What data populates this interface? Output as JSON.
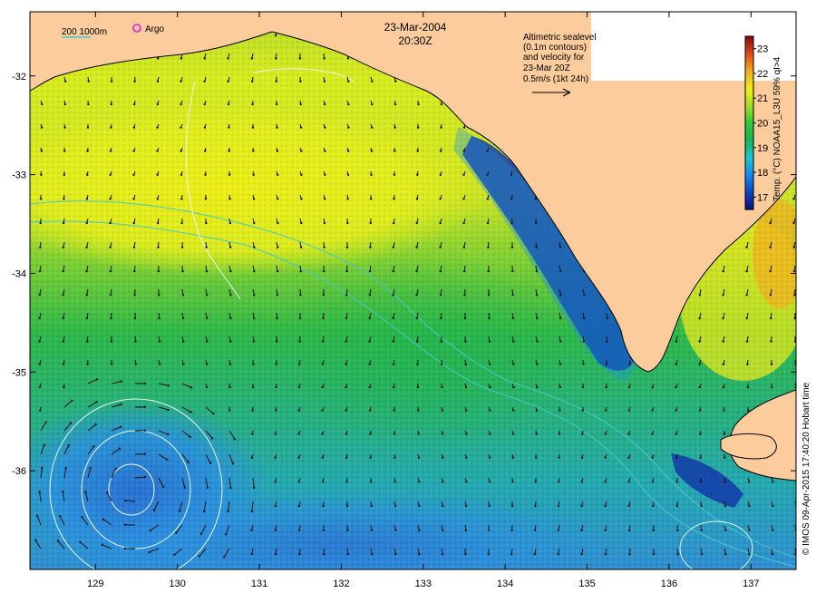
{
  "header": {
    "date": "23-Mar-2004",
    "time": "20:30Z"
  },
  "legend": {
    "isobath_label": "200  1000m",
    "argo_label": "Argo",
    "isobath_color": "#46c8c8",
    "argo_color": "#e020e0"
  },
  "annotation": {
    "lines": [
      "Altimetric sealevel",
      "(0.1m contours)",
      "and velocity for",
      "23-Mar 20Z",
      "0.5m/s (1kt 24h)"
    ]
  },
  "colorbar": {
    "label": "Temp. (°C) NOAA15_L3U 59% qI>4",
    "ticks": [
      "17",
      "18",
      "19",
      "20",
      "21",
      "22",
      "23"
    ],
    "range": [
      16.5,
      23.5
    ],
    "stops": [
      "#0a1478",
      "#0a46c8",
      "#148cf0",
      "#19c8d2",
      "#14b45a",
      "#2ec83c",
      "#a0dc28",
      "#f0f014",
      "#f0b41e",
      "#e6501e",
      "#8c0f0f"
    ]
  },
  "map": {
    "x_ticks": [
      "129",
      "130",
      "131",
      "132",
      "133",
      "134",
      "135",
      "136",
      "137"
    ],
    "y_ticks": [
      "-32",
      "-33",
      "-34",
      "-35",
      "-36"
    ],
    "lon_range": [
      128.2,
      137.55
    ],
    "lat_range": [
      -37.0,
      -31.35
    ],
    "land_color": "#fccc9c"
  },
  "credit": "© IMOS 09-Apr-2015 17:40:20 Hobart time"
}
